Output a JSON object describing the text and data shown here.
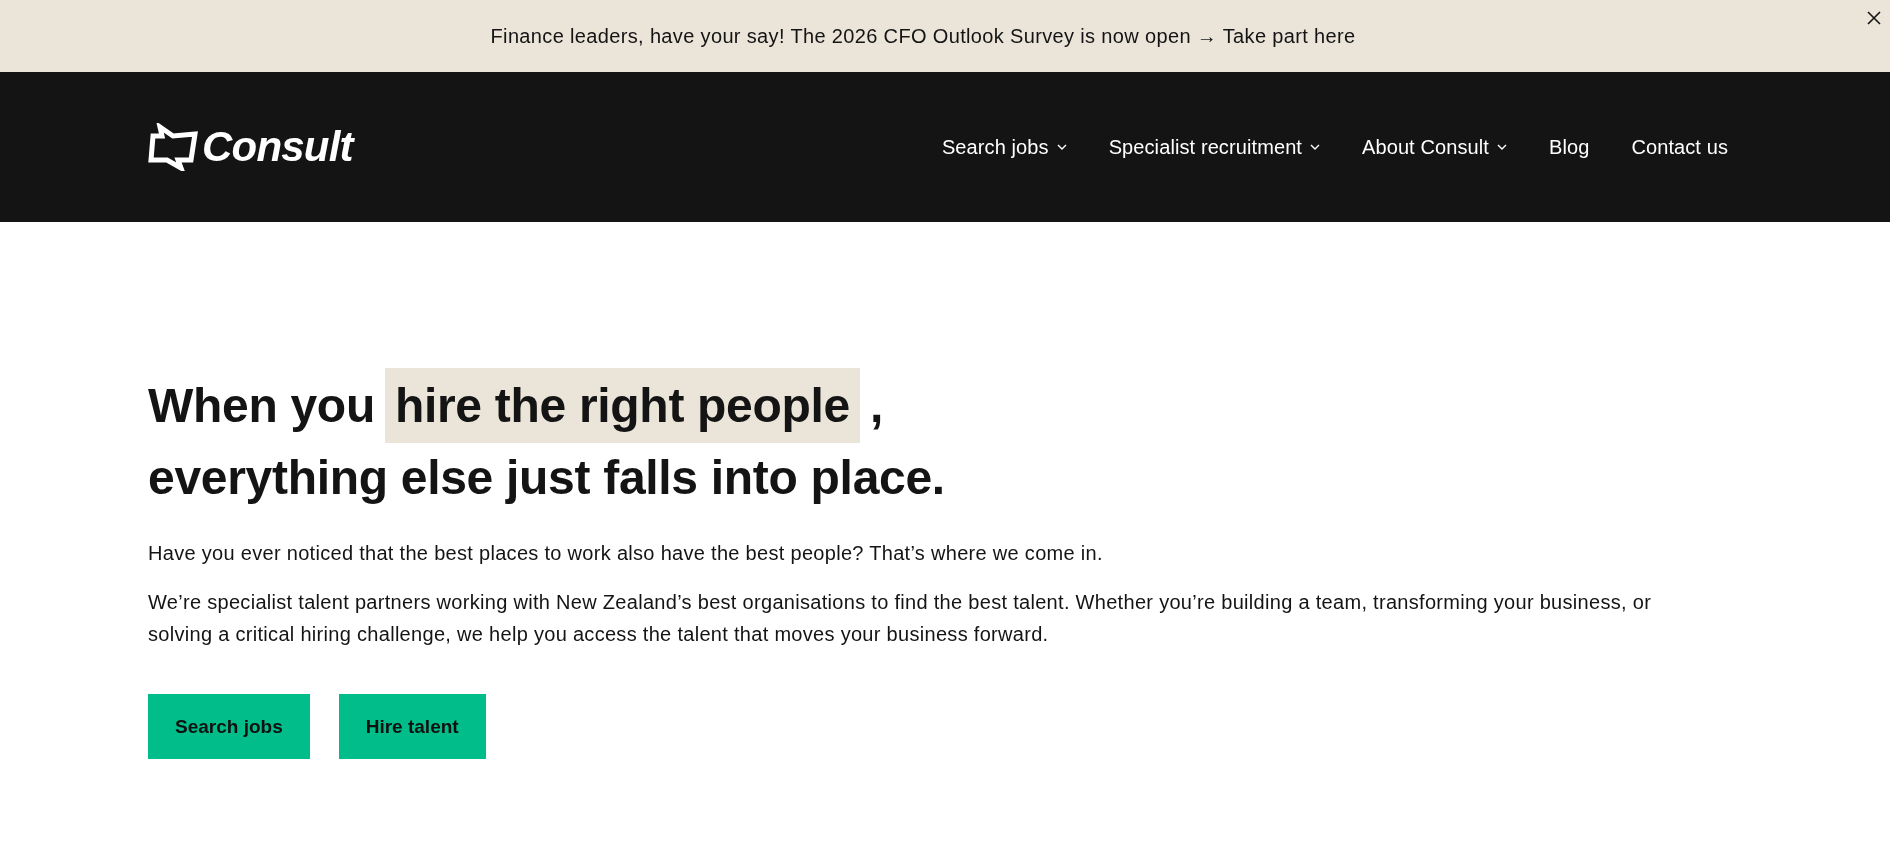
{
  "announcement_bar": {
    "text": "Finance leaders, have your say! The 2026 CFO Outlook Survey is now open → Take part here"
  },
  "header": {
    "logo_text": "Consult",
    "nav": [
      {
        "label": "Search jobs",
        "kind": "dropdown"
      },
      {
        "label": "Specialist recruitment",
        "kind": "dropdown"
      },
      {
        "label": "About Consult",
        "kind": "dropdown"
      },
      {
        "label": "Blog",
        "kind": "link"
      },
      {
        "label": "Contact us",
        "kind": "link"
      }
    ]
  },
  "hero": {
    "heading": {
      "before": "When you",
      "highlight": "hire the right people",
      "after": ",",
      "line_2": "everything else just falls into place."
    },
    "paragraphs": [
      "Have you ever noticed that the best places to work also have the best people? That’s where we come in.",
      "We’re specialist talent partners working with New Zealand’s best organisations to find the best talent. Whether you’re building a team, transforming your business, or solving a critical hiring challenge, we help you access the talent that moves your business forward."
    ],
    "buttons": [
      "Search jobs",
      "Hire talent"
    ]
  }
}
